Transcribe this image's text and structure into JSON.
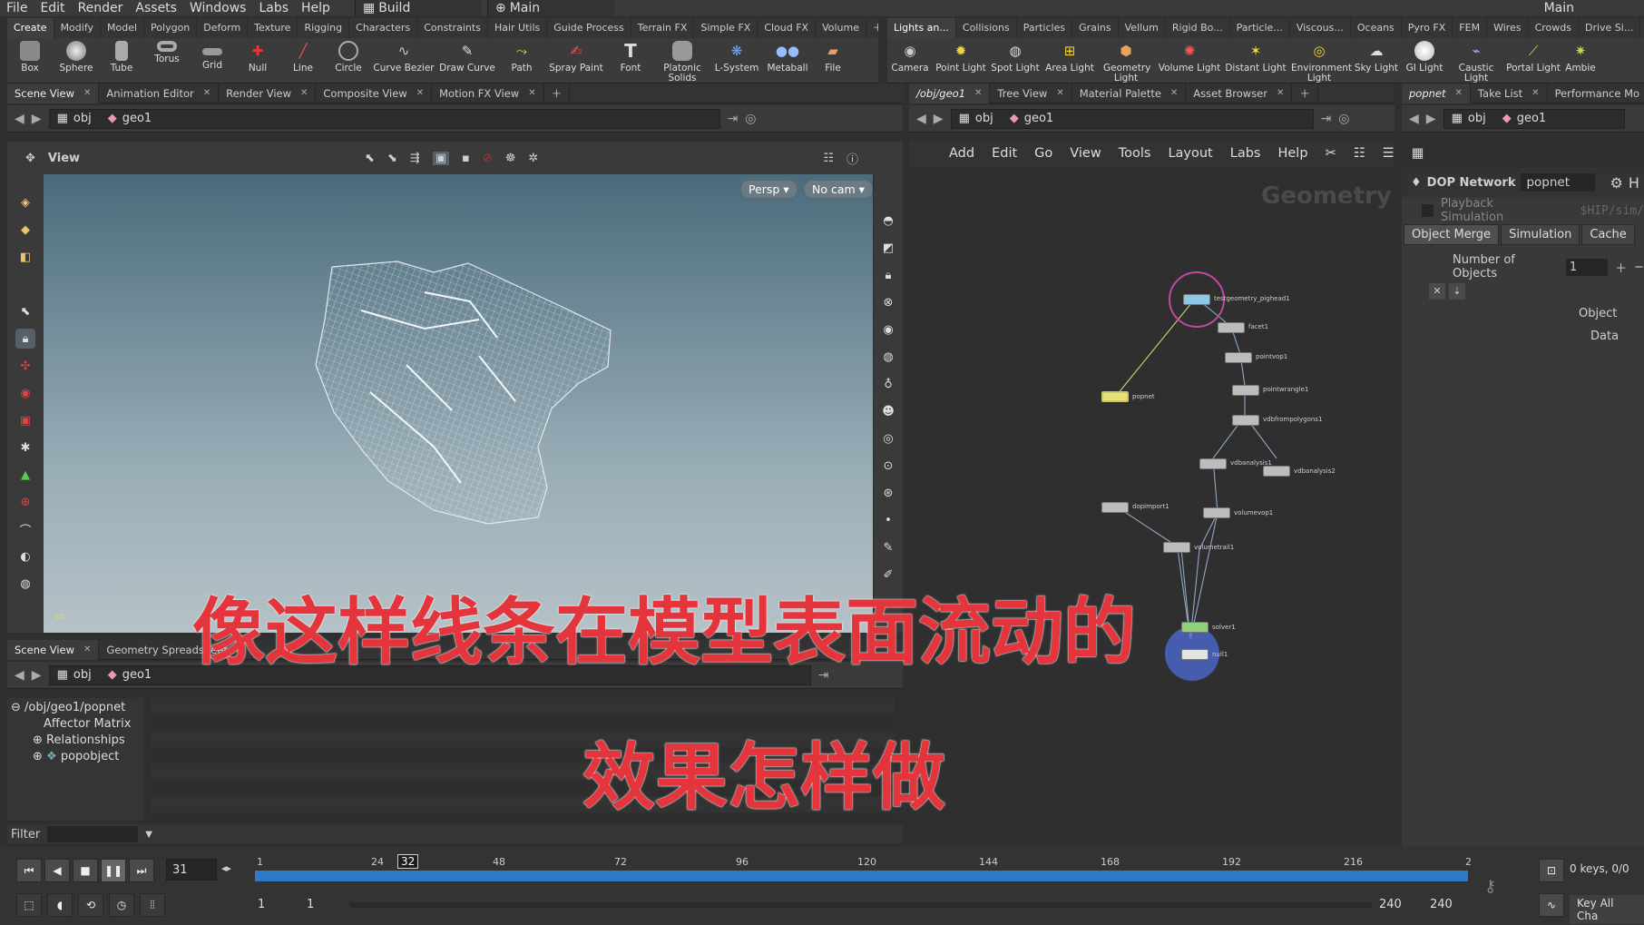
{
  "menubar": {
    "items": [
      "File",
      "Edit",
      "Render",
      "Assets",
      "Windows",
      "Labs",
      "Help"
    ],
    "desktop": "Build",
    "context": "Main",
    "right_label": "Main"
  },
  "shelf_left": {
    "tabs": [
      "Create",
      "Modify",
      "Model",
      "Polygon",
      "Deform",
      "Texture",
      "Rigging",
      "Characters",
      "Constraints",
      "Hair Utils",
      "Guide Process",
      "Terrain FX",
      "Simple FX",
      "Cloud FX",
      "Volume"
    ],
    "tools": [
      "Box",
      "Sphere",
      "Tube",
      "Torus",
      "Grid",
      "Null",
      "Line",
      "Circle",
      "Curve Bezier",
      "Draw Curve",
      "Path",
      "Spray Paint",
      "Font",
      "Platonic Solids",
      "L-System",
      "Metaball",
      "File"
    ]
  },
  "shelf_right": {
    "tabs": [
      "Lights an...",
      "Collisions",
      "Particles",
      "Grains",
      "Vellum",
      "Rigid Bo...",
      "Particle...",
      "Viscous...",
      "Oceans",
      "Pyro FX",
      "FEM",
      "Wires",
      "Crowds",
      "Drive Si..."
    ],
    "tools": [
      "Camera",
      "Point Light",
      "Spot Light",
      "Area Light",
      "Geometry Light",
      "Volume Light",
      "Distant Light",
      "Environment Light",
      "Sky Light",
      "GI Light",
      "Caustic Light",
      "Portal Light",
      "Ambie"
    ]
  },
  "left_tabs": [
    "Scene View",
    "Animation Editor",
    "Render View",
    "Composite View",
    "Motion FX View"
  ],
  "path_obj": "obj",
  "path_geo": "geo1",
  "viewport": {
    "label": "View",
    "persp": "Persp ▾",
    "cam": "No cam ▾"
  },
  "bottom_tabs": [
    "Scene View",
    "Geometry Spreadsheet"
  ],
  "tree": [
    "/obj/geo1/popnet",
    "Affector Matrix",
    "Relationships",
    "popobject"
  ],
  "filter_label": "Filter",
  "network_tabs": [
    "/obj/geo1",
    "Tree View",
    "Material Palette",
    "Asset Browser"
  ],
  "network_menu": [
    "Add",
    "Edit",
    "Go",
    "View",
    "Tools",
    "Layout",
    "Labs",
    "Help"
  ],
  "network_watermark": "Geometry",
  "nodes": [
    "testgeometry_pighead1",
    "facet1",
    "pointvop1",
    "pointwrangle1",
    "vdbfrompolygons1",
    "vdbanalysis1",
    "vdbanalysis2",
    "dopimport1",
    "volumevop1",
    "volumetrail1",
    "popnet",
    "solver1",
    "null1"
  ],
  "params_tabs": [
    "popnet",
    "Take List",
    "Performance Mo"
  ],
  "params": {
    "type": "DOP Network",
    "name": "popnet",
    "playback": "Playback Simulation",
    "sim_path": "$HIP/sim/",
    "subtabs": [
      "Object Merge",
      "Simulation",
      "Cache"
    ],
    "num_label": "Number of Objects",
    "num_value": "1",
    "object_label": "Object",
    "data_label": "Data"
  },
  "subtitle": {
    "line1": "像这样线条在模型表面流动的",
    "line2": "效果怎样做"
  },
  "timeline": {
    "frame": "31",
    "current": "32",
    "ticks": [
      "1",
      "24",
      "48",
      "72",
      "96",
      "120",
      "144",
      "168",
      "192",
      "216",
      "2"
    ],
    "start": "1",
    "start2": "1",
    "end": "240",
    "end2": "240",
    "keys": "0 keys, 0/0",
    "key_all": "Key All Cha"
  },
  "colors": {
    "accent": "#4a90d9",
    "subtitle": "#e4343c",
    "timeline_bar": "#2f78c8"
  }
}
